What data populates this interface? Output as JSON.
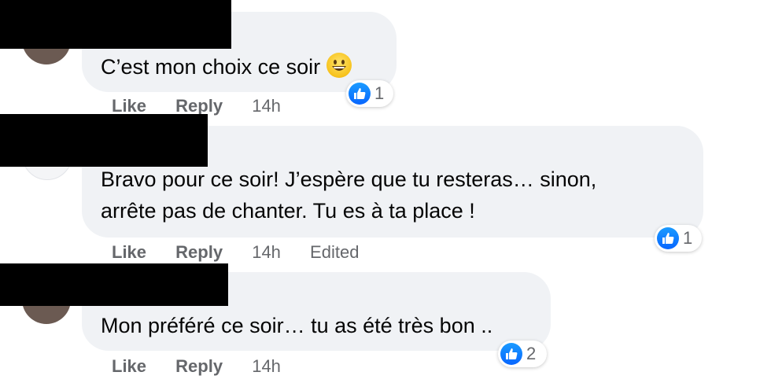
{
  "comments": [
    {
      "text": "C’est mon choix ce soir",
      "emoji": "grinning-face",
      "reaction_count": "1",
      "actions": {
        "like": "Like",
        "reply": "Reply",
        "time": "14h",
        "edited": ""
      }
    },
    {
      "text_line1": "Bravo pour ce soir! J’espère que tu resteras… sinon,",
      "text_line2": "arrête pas de chanter. Tu es à ta place !",
      "reaction_count": "1",
      "actions": {
        "like": "Like",
        "reply": "Reply",
        "time": "14h",
        "edited": "Edited"
      }
    },
    {
      "text": "Mon préféré ce soir… tu as été très bon ..",
      "reaction_count": "2",
      "actions": {
        "like": "Like",
        "reply": "Reply",
        "time": "14h",
        "edited": ""
      }
    }
  ],
  "colors": {
    "bubble": "#f0f2f5",
    "like_blue": "#0866ff",
    "meta_gray": "#65676b",
    "redaction": "#000000"
  },
  "icons": {
    "reaction": "thumbs-up-icon",
    "emoji": "grinning-face-emoji"
  }
}
